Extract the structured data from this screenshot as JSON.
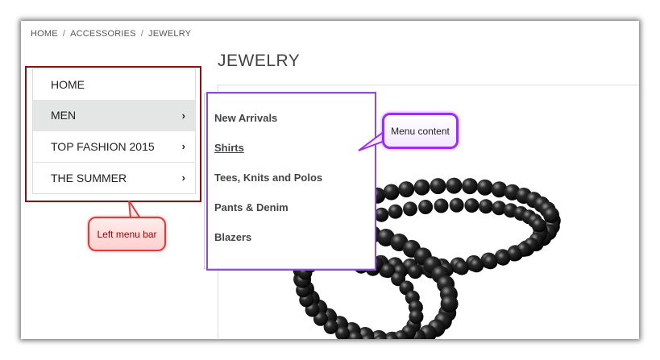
{
  "breadcrumb": {
    "items": [
      "HOME",
      "ACCESSORIES",
      "JEWELRY"
    ],
    "separator": "/"
  },
  "page": {
    "title": "JEWELRY"
  },
  "left_menu": {
    "items": [
      {
        "label": "HOME",
        "has_arrow": false,
        "active": false
      },
      {
        "label": "MEN",
        "has_arrow": true,
        "active": true
      },
      {
        "label": "TOP FASHION 2015",
        "has_arrow": true,
        "active": false
      },
      {
        "label": "THE SUMMER",
        "has_arrow": true,
        "active": false
      }
    ],
    "arrow_glyph": "›"
  },
  "submenu": {
    "items": [
      {
        "label": "New Arrivals",
        "hover": false
      },
      {
        "label": "Shirts",
        "hover": true
      },
      {
        "label": "Tees, Knits and Polos",
        "hover": false
      },
      {
        "label": "Pants & Denim",
        "hover": false
      },
      {
        "label": "Blazers",
        "hover": false
      }
    ]
  },
  "annotations": {
    "menu_content": "Menu content",
    "left_menu_bar": "Left menu bar"
  },
  "colors": {
    "left_highlight": "#8b1010",
    "submenu_highlight": "#8a4fd6",
    "callout_purple": "#9b2ff0",
    "callout_red": "#e23a3a",
    "active_item_bg": "#e4e6e6"
  },
  "icons": {
    "product_image": "black-bead-necklace-icon"
  }
}
